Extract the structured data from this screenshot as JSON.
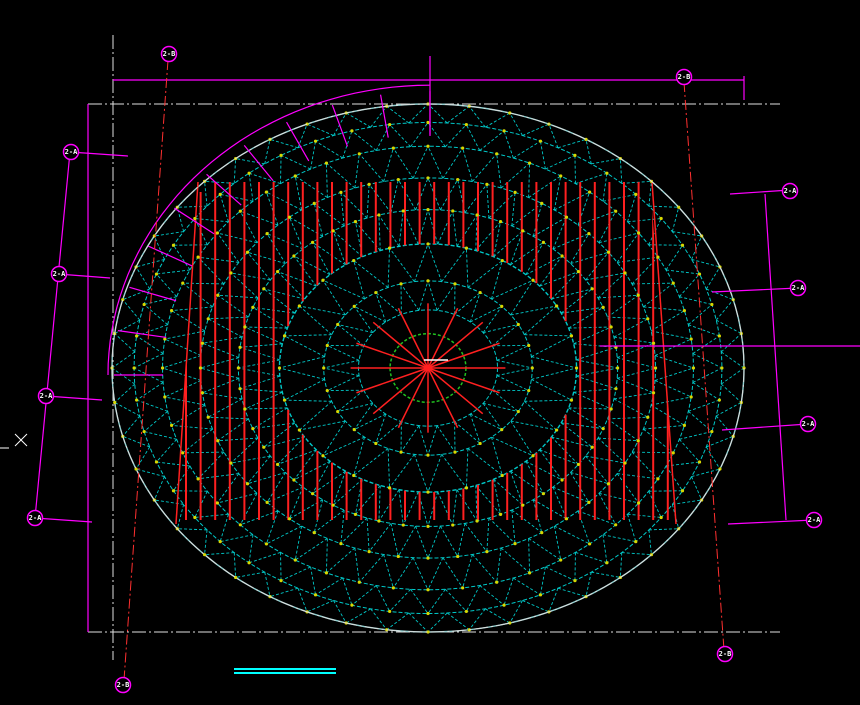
{
  "colors": {
    "background": "#000000",
    "dimension": "#ff00ff",
    "grid_mesh": "#00c8c8",
    "nodes": "#d8d800",
    "purlins": "#ff2020",
    "center_ring": "#20c020",
    "border": "#dcdcdc",
    "scale_bar": "#00ffff"
  },
  "axis_bubbles": [
    {
      "id": "top-left",
      "label": "2-B"
    },
    {
      "id": "top-right",
      "label": "2-B"
    },
    {
      "id": "bottom-left",
      "label": "2-B"
    },
    {
      "id": "bottom-right",
      "label": "2-B"
    },
    {
      "id": "left-1",
      "label": "2-A"
    },
    {
      "id": "left-2",
      "label": "2-A"
    },
    {
      "id": "left-3",
      "label": "2-A"
    },
    {
      "id": "left-4",
      "label": "2-A"
    },
    {
      "id": "right-1",
      "label": "2-A"
    },
    {
      "id": "right-2",
      "label": "2-A"
    },
    {
      "id": "right-3",
      "label": "2-A"
    },
    {
      "id": "right-4",
      "label": "2-A"
    }
  ],
  "icons": {
    "ucs": "ucs-cross-icon"
  }
}
